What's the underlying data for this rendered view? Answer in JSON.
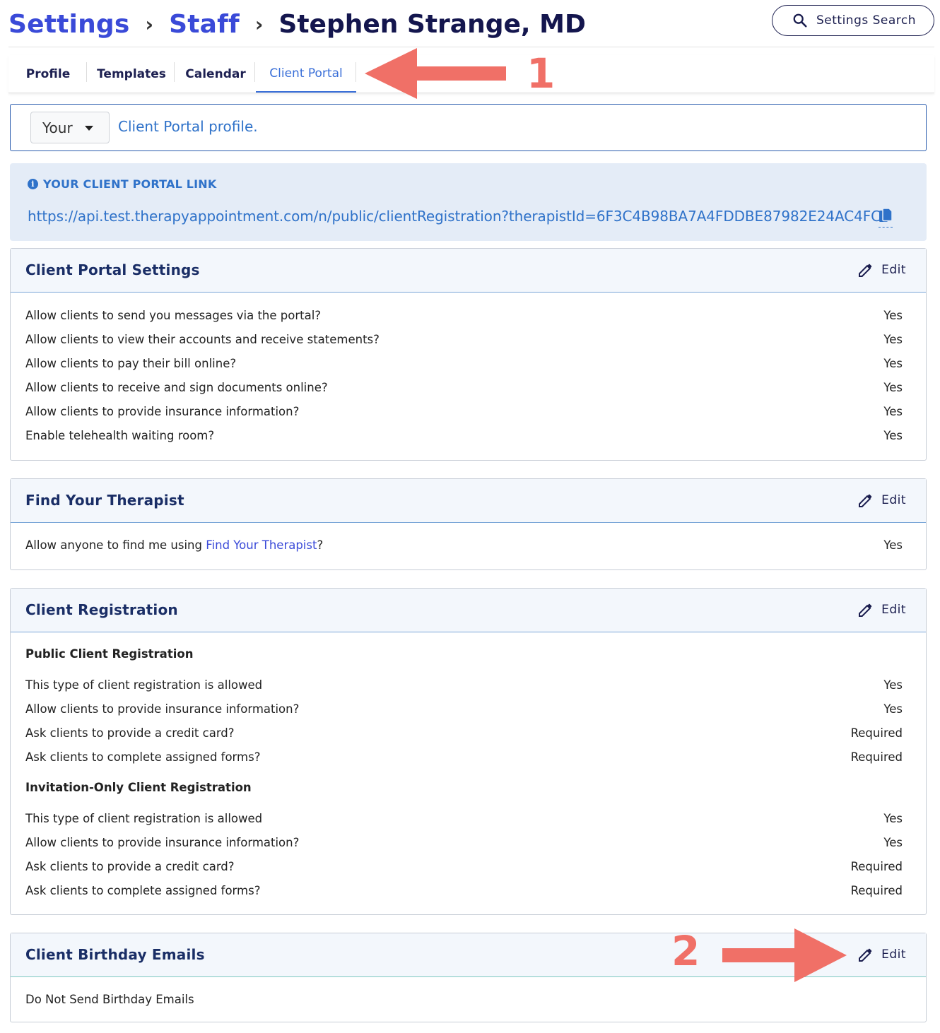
{
  "breadcrumb": {
    "items": [
      "Settings",
      "Staff"
    ],
    "current": "Stephen Strange, MD"
  },
  "search": {
    "label": "Settings Search"
  },
  "tabs": [
    {
      "label": "Profile",
      "active": false
    },
    {
      "label": "Templates",
      "active": false
    },
    {
      "label": "Calendar",
      "active": false
    },
    {
      "label": "Client Portal",
      "active": true
    }
  ],
  "annotations": {
    "one": "1",
    "two": "2",
    "arrow_color": "#f07067"
  },
  "profile_bar": {
    "select_value": "Your",
    "text": "Client Portal profile."
  },
  "portal_link": {
    "heading": "YOUR CLIENT PORTAL LINK",
    "url": "https://api.test.therapyappointment.com/n/public/clientRegistration?therapistId=6F3C4B98BA7A4FDDBE87982E24AC4FCB",
    "copy_icon": "copy-icon"
  },
  "panels": {
    "portal_settings": {
      "title": "Client Portal Settings",
      "edit": "Edit",
      "rows": [
        {
          "label": "Allow clients to send you messages via the portal?",
          "value": "Yes"
        },
        {
          "label": "Allow clients to view their accounts and receive statements?",
          "value": "Yes"
        },
        {
          "label": "Allow clients to pay their bill online?",
          "value": "Yes"
        },
        {
          "label": "Allow clients to receive and sign documents online?",
          "value": "Yes"
        },
        {
          "label": "Allow clients to provide insurance information?",
          "value": "Yes"
        },
        {
          "label": "Enable telehealth waiting room?",
          "value": "Yes"
        }
      ]
    },
    "find_therapist": {
      "title": "Find Your Therapist",
      "edit": "Edit",
      "row_prefix": "Allow anyone to find me using ",
      "row_link": "Find Your Therapist",
      "row_suffix": "?",
      "value": "Yes"
    },
    "registration": {
      "title": "Client Registration",
      "edit": "Edit",
      "public_heading": "Public Client Registration",
      "public_rows": [
        {
          "label": "This type of client registration is allowed",
          "value": "Yes"
        },
        {
          "label": "Allow clients to provide insurance information?",
          "value": "Yes"
        },
        {
          "label": "Ask clients to provide a credit card?",
          "value": "Required"
        },
        {
          "label": "Ask clients to complete assigned forms?",
          "value": "Required"
        }
      ],
      "invite_heading": "Invitation-Only Client Registration",
      "invite_rows": [
        {
          "label": "This type of client registration is allowed",
          "value": "Yes"
        },
        {
          "label": "Allow clients to provide insurance information?",
          "value": "Yes"
        },
        {
          "label": "Ask clients to provide a credit card?",
          "value": "Required"
        },
        {
          "label": "Ask clients to complete assigned forms?",
          "value": "Required"
        }
      ]
    },
    "birthday": {
      "title": "Client Birthday Emails",
      "edit": "Edit",
      "text": "Do Not Send Birthday Emails"
    }
  }
}
